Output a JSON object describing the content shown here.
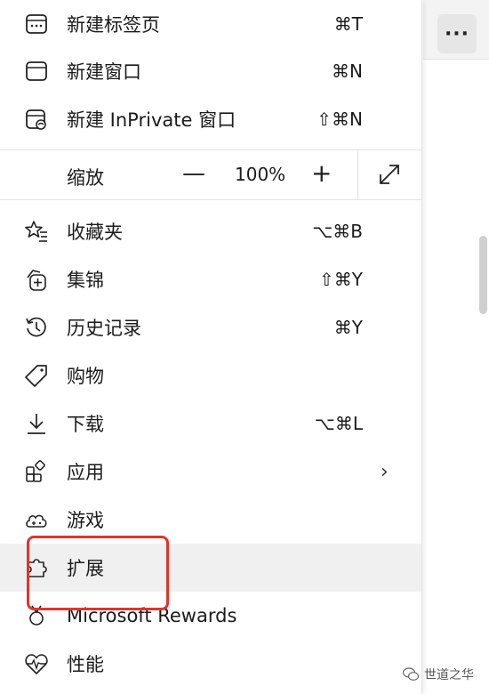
{
  "toolbar": {
    "more_label": "···"
  },
  "menu": {
    "items_top": [
      {
        "label": "新建标签页",
        "shortcut": "⌘T",
        "icon": "new-tab-icon"
      },
      {
        "label": "新建窗口",
        "shortcut": "⌘N",
        "icon": "new-window-icon"
      },
      {
        "label": "新建 InPrivate 窗口",
        "shortcut": "⇧⌘N",
        "icon": "inprivate-icon"
      }
    ],
    "zoom": {
      "label": "缩放",
      "minus": "—",
      "value": "100%",
      "plus": "+"
    },
    "items_bottom": [
      {
        "label": "收藏夹",
        "shortcut": "⌥⌘B",
        "icon": "favorites-icon"
      },
      {
        "label": "集锦",
        "shortcut": "⇧⌘Y",
        "icon": "collections-icon"
      },
      {
        "label": "历史记录",
        "shortcut": "⌘Y",
        "icon": "history-icon"
      },
      {
        "label": "购物",
        "shortcut": "",
        "icon": "shopping-tag-icon"
      },
      {
        "label": "下载",
        "shortcut": "⌥⌘L",
        "icon": "download-icon"
      },
      {
        "label": "应用",
        "shortcut": "",
        "icon": "apps-icon",
        "submenu": "›"
      },
      {
        "label": "游戏",
        "shortcut": "",
        "icon": "games-icon"
      },
      {
        "label": "扩展",
        "shortcut": "",
        "icon": "extensions-icon"
      },
      {
        "label": "Microsoft Rewards",
        "shortcut": "",
        "icon": "rewards-icon"
      },
      {
        "label": "性能",
        "shortcut": "",
        "icon": "performance-icon"
      }
    ]
  },
  "watermark": {
    "text": "世道之华"
  },
  "colors": {
    "highlight_box": "#e0352b",
    "hover_bg": "#f0f0f0"
  }
}
